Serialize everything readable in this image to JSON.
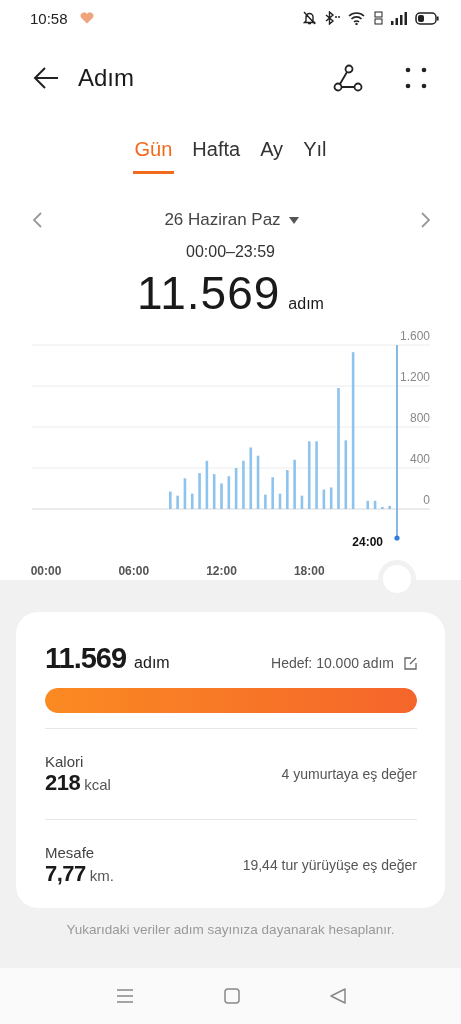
{
  "status_bar": {
    "time": "10:58"
  },
  "app_bar": {
    "title": "Adım"
  },
  "period_tabs": [
    {
      "label": "Gün",
      "selected": true
    },
    {
      "label": "Hafta",
      "selected": false
    },
    {
      "label": "Ay",
      "selected": false
    },
    {
      "label": "Yıl",
      "selected": false
    }
  ],
  "date_nav": {
    "date": "26 Haziran Paz",
    "time_range": "00:00–23:59"
  },
  "total": {
    "value": "11.569",
    "unit": "adım"
  },
  "chart": {
    "cursor_label": "24:00",
    "chart_data": {
      "type": "bar",
      "x": [
        8.5,
        9,
        9.5,
        10,
        10.5,
        11,
        11.5,
        12,
        12.5,
        13,
        13.5,
        14,
        14.5,
        15,
        15.5,
        16,
        16.5,
        17,
        17.5,
        18,
        18.5,
        19,
        19.5,
        20,
        20.5,
        21,
        22,
        22.5,
        23,
        23.5
      ],
      "values": [
        170,
        130,
        300,
        150,
        350,
        470,
        340,
        250,
        320,
        400,
        470,
        600,
        520,
        140,
        310,
        150,
        380,
        480,
        130,
        660,
        660,
        190,
        210,
        1180,
        670,
        1530,
        80,
        80,
        20,
        30
      ],
      "grid": true,
      "xlim": [
        0,
        24
      ],
      "ylim": [
        0,
        1600
      ],
      "xticks": [
        {
          "value": 0,
          "label": "00:00"
        },
        {
          "value": 6,
          "label": "06:00"
        },
        {
          "value": 12,
          "label": "12:00"
        },
        {
          "value": 18,
          "label": "18:00"
        }
      ],
      "yticks": [
        {
          "value": 0,
          "label": "0"
        },
        {
          "value": 400,
          "label": "400"
        },
        {
          "value": 800,
          "label": "800"
        },
        {
          "value": 1200,
          "label": "1.200"
        },
        {
          "value": 1600,
          "label": "1.600"
        }
      ]
    }
  },
  "summary": {
    "steps_value": "11.569",
    "steps_unit": "adım",
    "goal": "Hedef: 10.000 adım",
    "level": 1.0,
    "stats": [
      {
        "label": "Kalori",
        "value": "218",
        "unit": "kcal",
        "note": "4 yumurtaya eş değer"
      },
      {
        "label": "Mesafe",
        "value": "7,77",
        "unit": "km.",
        "note": "19,44 tur yürüyüşe eş değer"
      }
    ]
  },
  "footnote": "Yukarıdaki veriler adım sayınıza dayanarak hesaplanır."
}
